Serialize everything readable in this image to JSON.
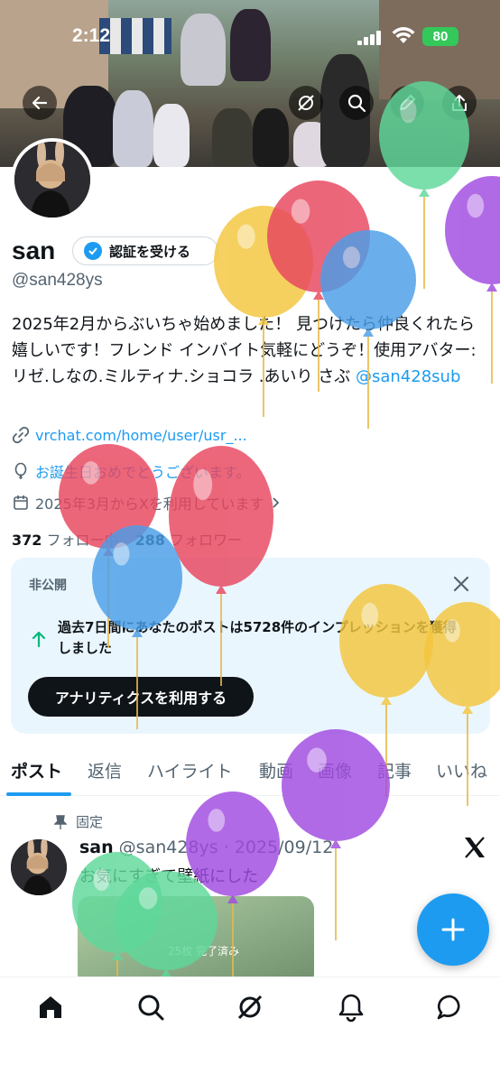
{
  "status_bar": {
    "time": "2:12",
    "battery": "80"
  },
  "profile": {
    "display_name": "san",
    "verify_label": "認証を受ける",
    "handle": "@san428ys",
    "bio_text": "2025年2月からぶいちゃ始めました！ 見つけたら仲良くれたら嬉しいです！フレンド インバイト気軽にどうぞ！使用アバター:リゼ.しなの.ミルティナ.ショコラ .あいり さぶ ",
    "bio_mention": "@san428sub",
    "link": "vrchat.com/home/user/usr_...",
    "birthday": "お誕生日おめでとうございます。",
    "joined": "2025年3月からXを利用しています",
    "following_count": "372",
    "following_label": "フォロー中",
    "followers_count": "288",
    "followers_label": "フォロワー"
  },
  "analytics": {
    "private_label": "非公開",
    "impressions_text": "過去7日間にあなたのポストは5728件のインプレッションを獲得しました",
    "button_label": "アナリティクスを利用する"
  },
  "tabs": [
    {
      "label": "ポスト",
      "active": true
    },
    {
      "label": "返信",
      "active": false
    },
    {
      "label": "ハイライト",
      "active": false
    },
    {
      "label": "動画",
      "active": false
    },
    {
      "label": "画像",
      "active": false
    },
    {
      "label": "記事",
      "active": false
    },
    {
      "label": "いいね",
      "active": false
    }
  ],
  "post": {
    "pinned_label": "固定",
    "author": "san",
    "handle_date": "@san428ys · 2025/09/12",
    "text": "お気にすぎて壁紙にした",
    "image_text": "25枚 完了済み"
  },
  "icons": {
    "back": "arrow-left-icon",
    "grok": "grok-icon",
    "search": "search-icon",
    "share": "share-icon",
    "link": "link-icon",
    "balloon": "balloon-icon",
    "calendar": "calendar-icon",
    "close": "close-icon",
    "arrow_up": "arrow-up-icon",
    "pin": "pin-icon",
    "x_logo": "x-logo-icon",
    "compose": "plus-icon",
    "home": "home-icon",
    "notifications": "bell-icon",
    "messages": "message-icon"
  },
  "colors": {
    "accent": "#1d9bf0",
    "text": "#0f1419",
    "muted": "#536471",
    "card": "#eaf6fd"
  }
}
